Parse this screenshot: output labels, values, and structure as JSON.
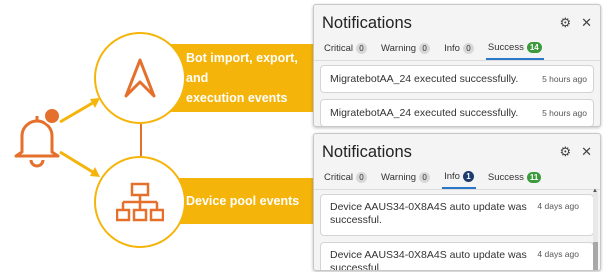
{
  "illustration": {
    "top_band_label_line1": "Bot import, export, and",
    "top_band_label_line2": "execution events",
    "bottom_band_label": "Device pool events",
    "accent_color": "#f5b40a",
    "bell_color": "#e4702c"
  },
  "panel_top": {
    "title": "Notifications",
    "tabs": [
      {
        "label": "Critical",
        "count": "0",
        "active": false
      },
      {
        "label": "Warning",
        "count": "0",
        "active": false
      },
      {
        "label": "Info",
        "count": "0",
        "active": false
      },
      {
        "label": "Success",
        "count": "14",
        "active": true
      }
    ],
    "items": [
      {
        "message": "MigratebotAA_24 executed successfully.",
        "time": "5 hours ago"
      },
      {
        "message": "MigratebotAA_24 executed successfully.",
        "time": "5 hours ago"
      }
    ]
  },
  "panel_bottom": {
    "title": "Notifications",
    "tabs": [
      {
        "label": "Critical",
        "count": "0",
        "active": false
      },
      {
        "label": "Warning",
        "count": "0",
        "active": false
      },
      {
        "label": "Info",
        "count": "1",
        "active": true
      },
      {
        "label": "Success",
        "count": "11",
        "active": false
      }
    ],
    "items": [
      {
        "message_line1": "Device AAUS34-0X8A4S auto update was",
        "message_line2": "successful.",
        "time": "4 days ago"
      },
      {
        "message_line1": "Device AAUS34-0X8A4S auto update was",
        "message_line2": "successful.",
        "time": "4 days ago"
      }
    ]
  },
  "icons": {
    "settings": "gear-icon",
    "close": "close-icon",
    "bell": "bell-icon",
    "automation": "automation-logo-icon",
    "device_pool": "device-pool-icon"
  }
}
